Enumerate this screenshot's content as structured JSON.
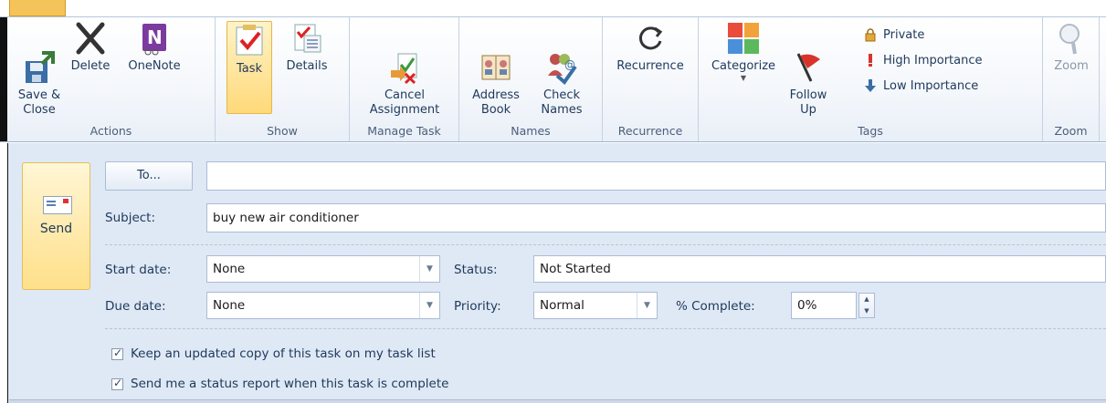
{
  "ribbon": {
    "groups": {
      "actions": {
        "label": "Actions",
        "save_close": "Save &\nClose",
        "delete": "Delete",
        "onenote": "OneNote"
      },
      "show": {
        "label": "Show",
        "task": "Task",
        "details": "Details"
      },
      "manage": {
        "label": "Manage Task",
        "cancel_assignment": "Cancel\nAssignment"
      },
      "names": {
        "label": "Names",
        "address_book": "Address\nBook",
        "check_names": "Check\nNames"
      },
      "recurrence": {
        "label": "Recurrence",
        "recurrence_btn": "Recurrence"
      },
      "tags": {
        "label": "Tags",
        "categorize": "Categorize",
        "follow_up": "Follow\nUp",
        "private": "Private",
        "high": "High Importance",
        "low": "Low Importance"
      },
      "zoom": {
        "label": "Zoom",
        "zoom_btn": "Zoom"
      }
    }
  },
  "form": {
    "send_label": "Send",
    "to_label": "To...",
    "to_value": "",
    "subject_label": "Subject:",
    "subject_value": "buy new air conditioner",
    "start_date_label": "Start date:",
    "start_date_value": "None",
    "due_date_label": "Due date:",
    "due_date_value": "None",
    "status_label": "Status:",
    "status_value": "Not Started",
    "priority_label": "Priority:",
    "priority_value": "Normal",
    "complete_label": "% Complete:",
    "complete_value": "0%",
    "check_keep_copy": "Keep an updated copy of this task on my task list",
    "check_status_report": "Send me a status report when this task is complete"
  },
  "colors": {
    "ribbon_bg": "#f4f7fb",
    "form_bg": "#dfe8f5",
    "active": "#ffd97a",
    "text": "#1e395b"
  }
}
